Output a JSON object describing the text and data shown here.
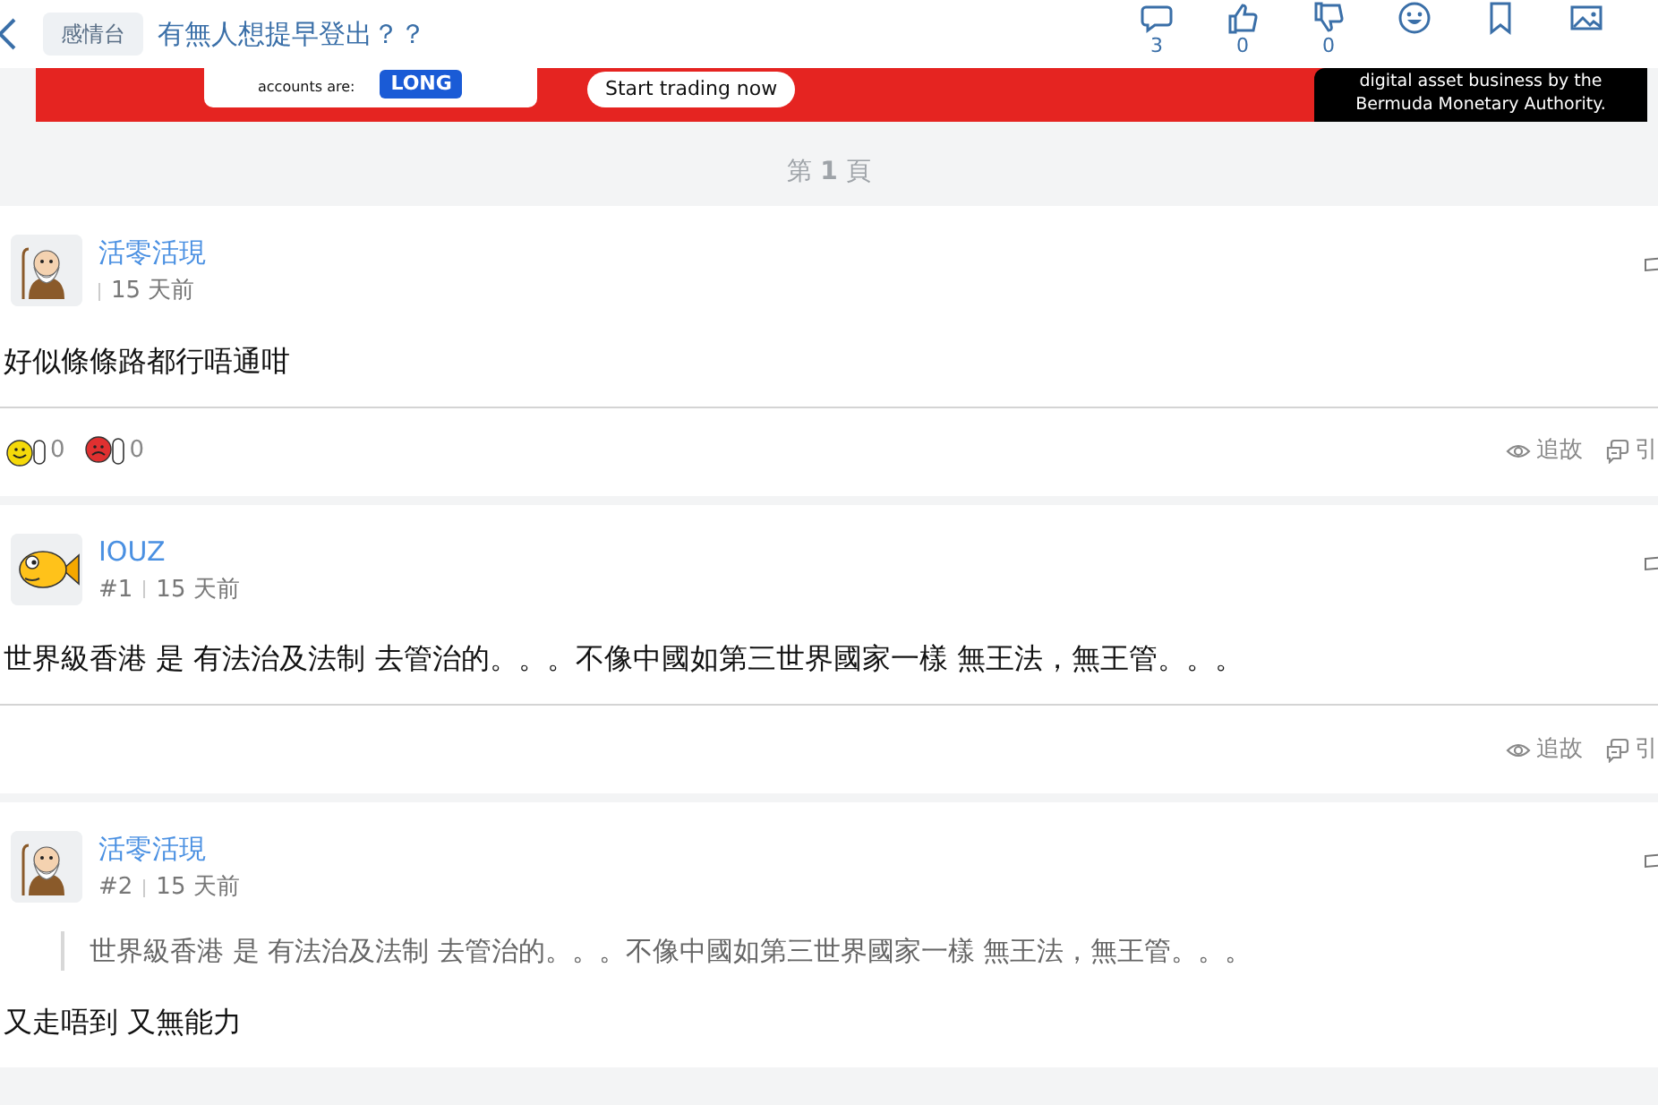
{
  "header": {
    "forum_tag": "感情台",
    "title": "有無人想提早登出？？",
    "stats": [
      {
        "kind": "comments",
        "count": "3"
      },
      {
        "kind": "like",
        "count": "0"
      },
      {
        "kind": "dislike",
        "count": "0"
      },
      {
        "kind": "emoji"
      },
      {
        "kind": "bookmark"
      },
      {
        "kind": "image"
      }
    ]
  },
  "ad_banner": {
    "left_text": "accounts are:",
    "left_badge": "LONG",
    "button": "Start trading now",
    "right_lines": [
      "digital asset business by the",
      "Bermuda Monetary Authority."
    ]
  },
  "page_label": "第 **1** 頁",
  "posts": [
    {
      "author": "活零活現",
      "avatar": {
        "kind": "old-man"
      },
      "time": "15 天前",
      "body": "好似條條路都行唔通咁",
      "reactions": [
        {
          "kind": "like",
          "count": "0"
        },
        {
          "kind": "dislike",
          "count": "0"
        }
      ],
      "actions": [
        {
          "kind": "follow",
          "label": "追故"
        },
        {
          "kind": "quote",
          "label": "引"
        }
      ]
    },
    {
      "author": "IOUZ",
      "avatar": {
        "kind": "fish"
      },
      "number": "#1",
      "time": "15 天前",
      "body": "世界級香港 是 有法治及法制 去管治的。。。不像中國如第三世界國家一樣 無王法，無王管。。。",
      "actions": [
        {
          "kind": "follow",
          "label": "追故"
        },
        {
          "kind": "quote",
          "label": "引"
        }
      ]
    },
    {
      "author": "活零活現",
      "avatar": {
        "kind": "old-man"
      },
      "number": "#2",
      "time": "15 天前",
      "quote": "世界級香港 是 有法治及法制 去管治的。。。不像中國如第三世界國家一樣 無王法，無王管。。。",
      "body": "又走唔到 又無能力"
    }
  ]
}
